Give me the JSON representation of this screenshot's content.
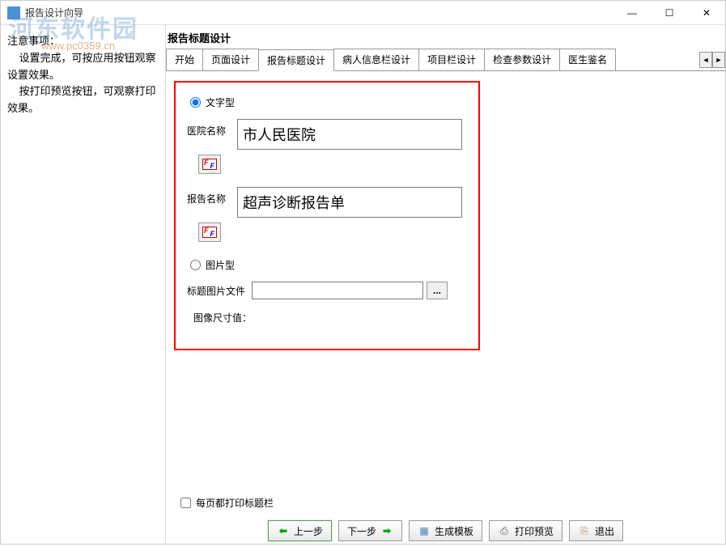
{
  "titlebar": {
    "title": "报告设计向导"
  },
  "watermark": {
    "main": "河东软件园",
    "sub": "www.pc0359.cn"
  },
  "sidebar": {
    "text": "注意事项：\n    设置完成，可按应用按钮观察设置效果。\n    按打印预览按钮，可观察打印效果。"
  },
  "section": {
    "title": "报告标题设计"
  },
  "tabs": {
    "items": [
      "开始",
      "页面设计",
      "报告标题设计",
      "病人信息栏设计",
      "项目栏设计",
      "检查参数设计",
      "医生鉴名"
    ],
    "activeIndex": 2
  },
  "form": {
    "radioText": "文字型",
    "radioImage": "图片型",
    "hospitalLabel": "医院名称",
    "hospitalValue": "市人民医院",
    "reportLabel": "报告名称",
    "reportValue": "超声诊断报告单",
    "imageFileLabel": "标题图片文件",
    "imageFileValue": "",
    "imageSizeLabel": "图像尺寸值：",
    "imageSizeValue": "",
    "browseBtn": "...",
    "printEveryPage": "每页都打印标题栏"
  },
  "buttons": {
    "prev": "上一步",
    "next": "下一步",
    "generate": "生成模板",
    "preview": "打印预览",
    "exit": "退出"
  }
}
